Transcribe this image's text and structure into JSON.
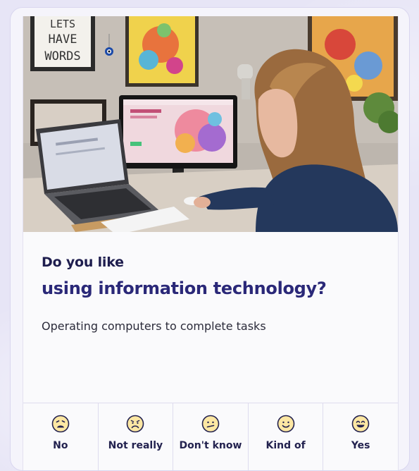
{
  "question": {
    "prefix": "Do you like",
    "subject": "using information technology?",
    "description": "Operating computers to complete tasks"
  },
  "photo": {
    "poster_text": [
      "LETS",
      "HAVE",
      "WORDS"
    ]
  },
  "answers": [
    {
      "label": "No",
      "icon": "frown-tired-face-icon"
    },
    {
      "label": "Not really",
      "icon": "sad-face-icon"
    },
    {
      "label": "Don't know",
      "icon": "neutral-face-icon"
    },
    {
      "label": "Kind of",
      "icon": "smile-face-icon"
    },
    {
      "label": "Yes",
      "icon": "grin-face-icon"
    }
  ],
  "colors": {
    "heading_dark": "#1e1d4e",
    "heading_accent": "#2a2878",
    "emoji_fill": "#fde7a3",
    "emoji_stroke": "#23224f"
  }
}
